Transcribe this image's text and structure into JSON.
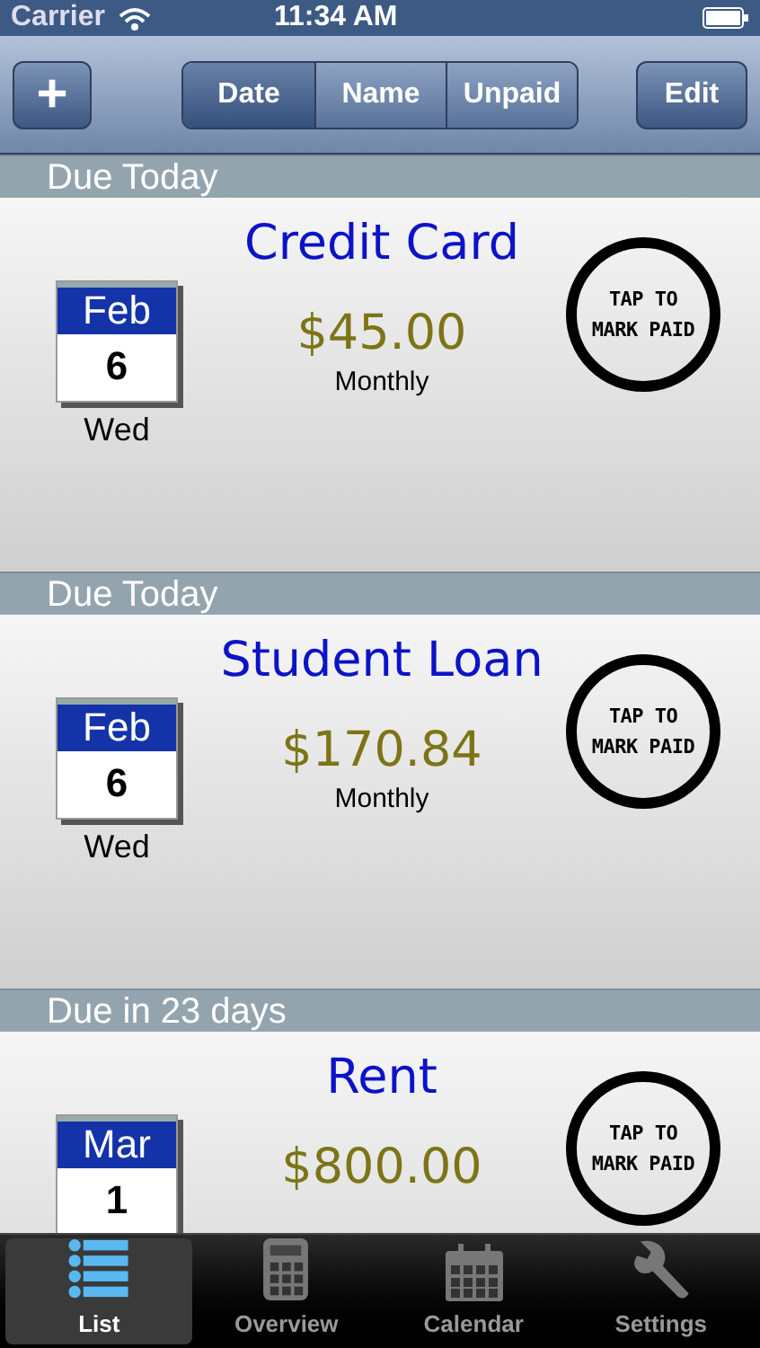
{
  "status_bar": {
    "carrier": "Carrier",
    "time": "11:34 AM"
  },
  "toolbar": {
    "add": "+",
    "sort_tabs": [
      {
        "label": "Date",
        "selected": true
      },
      {
        "label": "Name",
        "selected": false
      },
      {
        "label": "Unpaid",
        "selected": false
      }
    ],
    "edit": "Edit"
  },
  "bills": [
    {
      "header": "Due Today",
      "name": "Credit Card",
      "month": "Feb",
      "day": "6",
      "weekday": "Wed",
      "amount": "$45.00",
      "frequency": "Monthly",
      "stamp": "TAP TO MARK PAID"
    },
    {
      "header": "Due Today",
      "name": "Student Loan",
      "month": "Feb",
      "day": "6",
      "weekday": "Wed",
      "amount": "$170.84",
      "frequency": "Monthly",
      "stamp": "TAP TO MARK PAID"
    },
    {
      "header": "Due in 23 days",
      "name": "Rent",
      "month": "Mar",
      "day": "1",
      "amount": "$800.00",
      "stamp": "TAP TO MARK PAID"
    }
  ],
  "tab_bar": [
    {
      "label": "List",
      "kind": "list",
      "selected": true
    },
    {
      "label": "Overview",
      "kind": "calculator",
      "selected": false
    },
    {
      "label": "Calendar",
      "kind": "calendar",
      "selected": false
    },
    {
      "label": "Settings",
      "kind": "wrench",
      "selected": false
    }
  ]
}
